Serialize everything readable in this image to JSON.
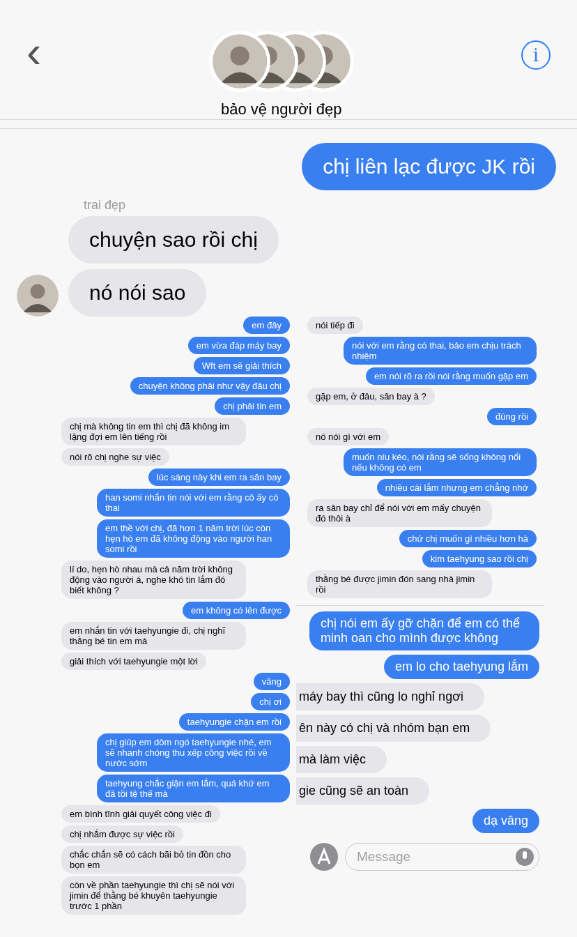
{
  "header": {
    "back": "‹",
    "title": "bảo vệ người đẹp",
    "info": "i"
  },
  "top_thread": {
    "messages": [
      {
        "kind": "sent",
        "text": "chị liên lạc được JK rồi"
      },
      {
        "kind": "sender",
        "text": "trai đẹp"
      },
      {
        "kind": "received",
        "text": "chuyện sao rồi chị"
      },
      {
        "kind": "received_avatar",
        "text": "nó nói sao"
      }
    ]
  },
  "left_thread": [
    {
      "kind": "sent",
      "text": "em đây"
    },
    {
      "kind": "sent",
      "text": "em vừa đáp máy bay"
    },
    {
      "kind": "sent",
      "text": "Wft em sẽ giải thích"
    },
    {
      "kind": "sent",
      "text": "chuyện không phải như vậy đâu chị"
    },
    {
      "kind": "sent",
      "text": "chị phải tin em"
    },
    {
      "kind": "received",
      "text": "chị mà không tin em thì chị đã không im lặng đợi em lên tiếng rồi"
    },
    {
      "kind": "received",
      "text": "nói rõ chị nghe sự việc"
    },
    {
      "kind": "sent",
      "text": "lúc sáng này khi em ra sân bay"
    },
    {
      "kind": "sent",
      "text": "han somi nhắn tin nói với em rằng cô ấy có thai"
    },
    {
      "kind": "sent",
      "text": "em thề với chị, đã hơn 1 năm trời lúc còn hẹn hò em đã không động vào người han somi rồi"
    },
    {
      "kind": "received",
      "text": "lí do, hẹn hò nhau mà cả năm trời không động vào người á, nghe khó tin lắm đó biết không ?"
    },
    {
      "kind": "sent",
      "text": "em không có lên được"
    },
    {
      "kind": "received",
      "text": "em nhắn tin với taehyungie đi, chị nghĩ thằng bé tin em mà"
    },
    {
      "kind": "received",
      "text": "giải thích với taehyungie một lời"
    },
    {
      "kind": "sent",
      "text": "vâng"
    },
    {
      "kind": "sent",
      "text": "chị ơi"
    },
    {
      "kind": "sent",
      "text": "taehyungie chặn em rồi"
    },
    {
      "kind": "sent",
      "text": "chị giúp em dòm ngó taehyungie nhé, em sẽ nhanh chóng thu xếp công việc rồi về nước sớm"
    },
    {
      "kind": "sent",
      "text": "taehyung chắc giận em lắm, quá khứ em đã tồi tệ thế mà"
    },
    {
      "kind": "received",
      "text": "em bình tĩnh giải quyết công việc đi"
    },
    {
      "kind": "received",
      "text": "chị nhắm được sự việc rồi"
    },
    {
      "kind": "received",
      "text": "chắc chắn sẽ có cách bãi bỏ tin đồn cho bọn em"
    },
    {
      "kind": "received",
      "text": "còn về phần taehyungie thì chị sẽ nói với jimin để thằng bé khuyên taehyungie trước 1 phần"
    }
  ],
  "right_thread": [
    {
      "kind": "received",
      "text": "nói tiếp đi"
    },
    {
      "kind": "sent",
      "text": "nói với em rằng có thai, bảo em chịu trách nhiệm"
    },
    {
      "kind": "sent",
      "text": "em nói rõ ra rồi nói rằng muốn gặp em"
    },
    {
      "kind": "received",
      "text": "gặp em, ở đâu, sân bay à ?"
    },
    {
      "kind": "sent",
      "text": "đúng rồi"
    },
    {
      "kind": "received",
      "text": "nó nói gì với em"
    },
    {
      "kind": "sent",
      "text": "muốn níu kéo, nói rằng sẽ sống không nổi nếu không có em"
    },
    {
      "kind": "sent",
      "text": "nhiều cái lắm nhưng em chẳng nhớ"
    },
    {
      "kind": "received",
      "text": "ra sân bay chỉ để nói với em mấy chuyện đó thôi à"
    },
    {
      "kind": "sent",
      "text": "chứ chị muốn gì nhiều hơn hà"
    },
    {
      "kind": "sent",
      "text": "kim taehyung sao rồi chị"
    },
    {
      "kind": "received",
      "text": "thằng bé được jimin đón sang nhà jimin rồi"
    }
  ],
  "right_lower_thread": [
    {
      "kind": "sent",
      "text": "chị nói em ấy gỡ chặn để em có thể minh oan cho mình được không"
    },
    {
      "kind": "sent",
      "text": "em lo cho taehyung lắm"
    },
    {
      "kind": "cut",
      "text": "máy bay thì cũng lo nghỉ ngơi"
    },
    {
      "kind": "cut",
      "text": "ên này có chị và nhóm bạn em"
    },
    {
      "kind": "cut",
      "text": "mà làm việc"
    },
    {
      "kind": "cut",
      "text": "gie cũng sẽ an toàn"
    },
    {
      "kind": "sent",
      "text": "dạ vâng"
    }
  ],
  "composer": {
    "placeholder": "Message"
  }
}
